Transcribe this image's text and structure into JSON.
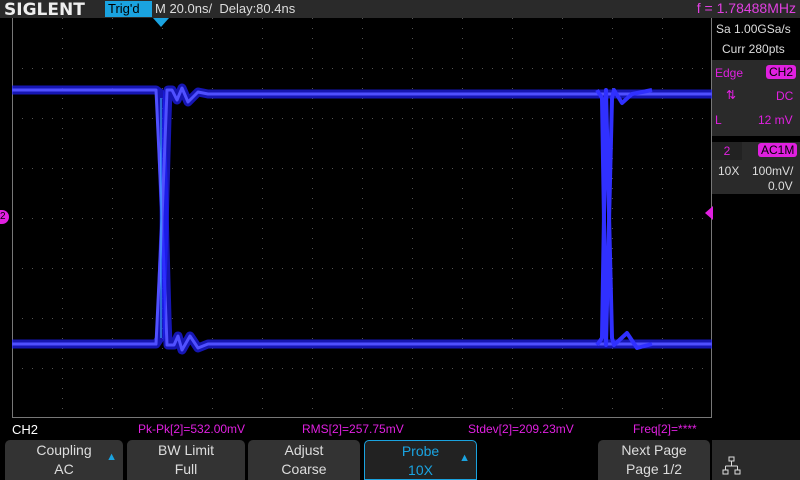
{
  "header": {
    "logo": "SIGLENT",
    "trigger_status": "Trig'd",
    "timebase": "M 20.0ns/",
    "delay": "Delay:80.4ns",
    "frequency": "f = 1.78488MHz"
  },
  "acquisition": {
    "sample_rate": "Sa 1.00GSa/s",
    "points": "Curr 280pts"
  },
  "trigger": {
    "type": "Edge",
    "source": "CH2",
    "slope_icon": "rise-fall-icon",
    "coupling": "DC",
    "level_label": "L",
    "level": "12 mV"
  },
  "channel": {
    "number": "2",
    "coupling": "AC1M",
    "probe": "10X",
    "scale": "100mV/",
    "offset": "0.0V",
    "marker": "2"
  },
  "measurements": {
    "channel": "CH2",
    "items": [
      "Pk-Pk[2]=532.00mV",
      "RMS[2]=257.75mV",
      "Stdev[2]=209.23mV",
      "Freq[2]=****"
    ]
  },
  "softkeys": [
    {
      "title": "Coupling",
      "value": "AC"
    },
    {
      "title": "BW Limit",
      "value": "Full"
    },
    {
      "title": "Adjust",
      "value": "Coarse"
    },
    {
      "title": "Probe",
      "value": "10X"
    },
    {
      "title": "Next Page",
      "value": "Page 1/2"
    }
  ],
  "colors": {
    "trace": "#3030ff",
    "accent": "#1aa3e0",
    "magenta": "#e020e0"
  }
}
